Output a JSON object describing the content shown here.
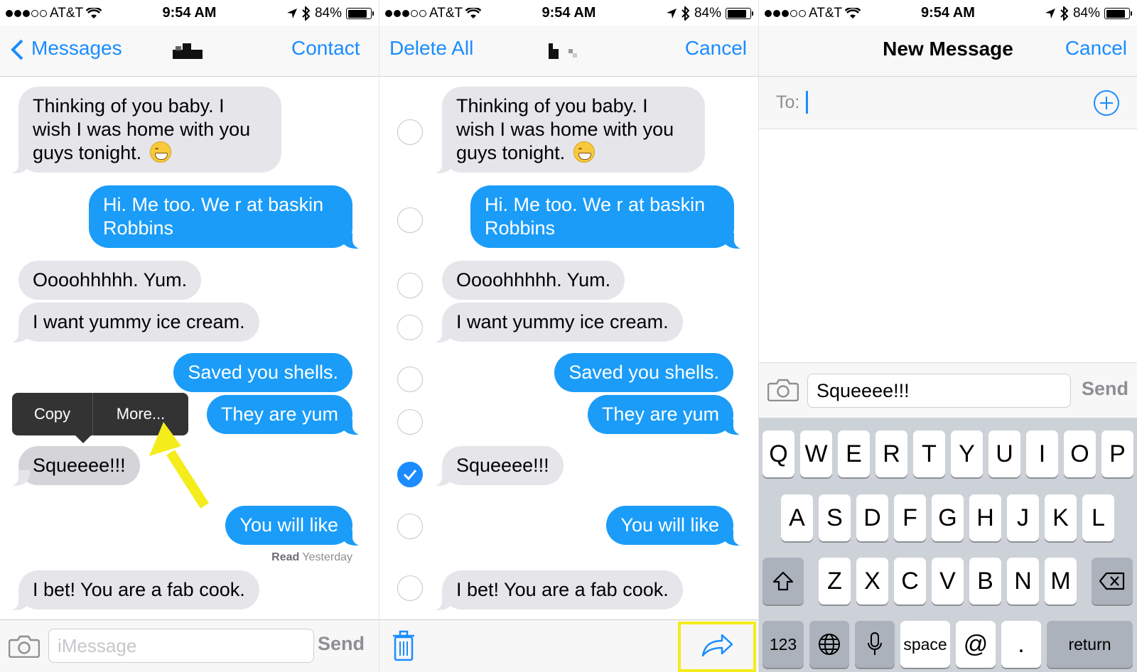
{
  "status": {
    "carrier": "AT&T",
    "time": "9:54 AM",
    "battery": "84%",
    "battery_level": 0.84
  },
  "panel1": {
    "nav": {
      "back": "Messages",
      "contact": "Contact"
    },
    "messages": [
      {
        "dir": "in",
        "text": "Thinking of you baby. I wish I was home with you guys tonight.",
        "emoji": "grimacing-face"
      },
      {
        "dir": "out",
        "text": "Hi. Me too. We r at baskin Robbins"
      },
      {
        "dir": "in",
        "text": "Oooohhhhh. Yum."
      },
      {
        "dir": "in",
        "text": "I want yummy ice cream."
      },
      {
        "dir": "out",
        "text": "Saved you shells."
      },
      {
        "dir": "out",
        "text": "They are yum"
      },
      {
        "dir": "in",
        "text": "Squeeee!!!"
      },
      {
        "dir": "out",
        "text": "You will like"
      },
      {
        "dir": "in",
        "text": "I bet! You are a fab cook."
      }
    ],
    "read_label": "Read",
    "read_time": "Yesterday",
    "popup": {
      "copy": "Copy",
      "more": "More..."
    },
    "input_placeholder": "iMessage",
    "send": "Send"
  },
  "panel2": {
    "nav": {
      "delete_all": "Delete All",
      "cancel": "Cancel"
    },
    "messages": [
      {
        "dir": "in",
        "text": "Thinking of you baby. I wish I was home with you guys tonight.",
        "emoji": "grimacing-face",
        "selected": false
      },
      {
        "dir": "out",
        "text": "Hi. Me too. We r at baskin Robbins",
        "selected": false
      },
      {
        "dir": "in",
        "text": "Oooohhhhh. Yum.",
        "selected": false
      },
      {
        "dir": "in",
        "text": "I want yummy ice cream.",
        "selected": false
      },
      {
        "dir": "out",
        "text": "Saved you shells.",
        "selected": false
      },
      {
        "dir": "out",
        "text": "They are yum",
        "selected": false
      },
      {
        "dir": "in",
        "text": "Squeeee!!!",
        "selected": true
      },
      {
        "dir": "out",
        "text": "You will like",
        "selected": false
      },
      {
        "dir": "in",
        "text": "I bet! You are a fab cook.",
        "selected": false
      }
    ],
    "toolbar_icons": [
      "trash-icon",
      "forward-icon"
    ]
  },
  "panel3": {
    "nav": {
      "title": "New Message",
      "cancel": "Cancel"
    },
    "to_label": "To:",
    "compose_text": "Squeeee!!!",
    "send": "Send",
    "keyboard": {
      "row1": [
        "Q",
        "W",
        "E",
        "R",
        "T",
        "Y",
        "U",
        "I",
        "O",
        "P"
      ],
      "row2": [
        "A",
        "S",
        "D",
        "F",
        "G",
        "H",
        "J",
        "K",
        "L"
      ],
      "row3": [
        "Z",
        "X",
        "C",
        "V",
        "B",
        "N",
        "M"
      ],
      "num": "123",
      "space": "space",
      "at": "@",
      "dot": ".",
      "return": "return"
    }
  },
  "colors": {
    "accent": "#1a8cff",
    "outgoing": "#1a9cf8",
    "incoming": "#e5e5ea",
    "highlight": "#f4ec1b"
  }
}
